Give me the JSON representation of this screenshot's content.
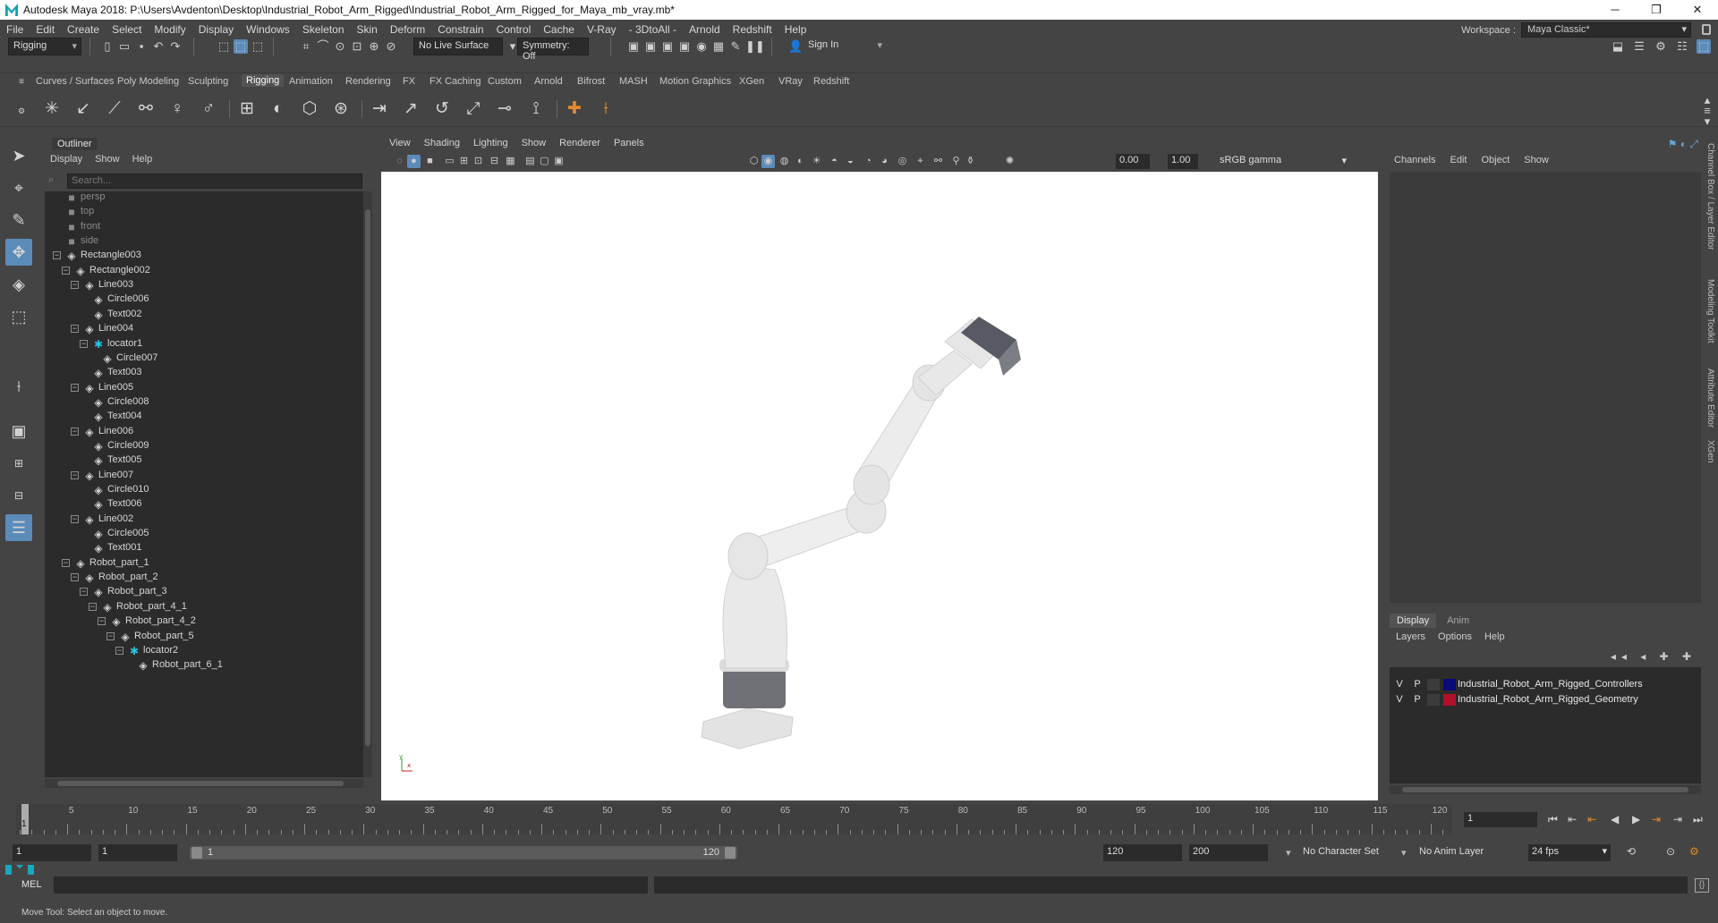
{
  "window": {
    "title": "Autodesk Maya 2018: P:\\Users\\Avdenton\\Desktop\\Industrial_Robot_Arm_Rigged\\Industrial_Robot_Arm_Rigged_for_Maya_mb_vray.mb*",
    "minimize": "─",
    "maximize": "❐",
    "close": "✕"
  },
  "menubar": {
    "items": [
      "File",
      "Edit",
      "Create",
      "Select",
      "Modify",
      "Display",
      "Windows",
      "Skeleton",
      "Skin",
      "Deform",
      "Constrain",
      "Control",
      "Cache",
      "V-Ray",
      "- 3DtoAll -",
      "Arnold",
      "Redshift",
      "Help"
    ],
    "workspace_label": "Workspace :",
    "workspace_value": "Maya Classic*"
  },
  "statusline": {
    "menuset": "Rigging",
    "live_surface": "No Live Surface",
    "symmetry": "Symmetry: Off",
    "sign_in": "Sign In"
  },
  "shelf": {
    "tabs": [
      "Curves / Surfaces",
      "Poly Modeling",
      "Sculpting",
      "Rigging",
      "Animation",
      "Rendering",
      "FX",
      "FX Caching",
      "Custom",
      "Arnold",
      "Bifrost",
      "MASH",
      "Motion Graphics",
      "XGen",
      "VRay",
      "Redshift"
    ],
    "active_tab": "Rigging"
  },
  "outliner": {
    "title": "Outliner",
    "menus": [
      "Display",
      "Show",
      "Help"
    ],
    "search_placeholder": "Search...",
    "rows": [
      {
        "label": "persp",
        "depth": 0,
        "type": "camera",
        "toggle": "",
        "dim": true
      },
      {
        "label": "top",
        "depth": 0,
        "type": "camera",
        "toggle": "",
        "dim": true
      },
      {
        "label": "front",
        "depth": 0,
        "type": "camera",
        "toggle": "",
        "dim": true
      },
      {
        "label": "side",
        "depth": 0,
        "type": "camera",
        "toggle": "",
        "dim": true
      },
      {
        "label": "Rectangle003",
        "depth": 0,
        "type": "transform",
        "toggle": "−",
        "dim": false
      },
      {
        "label": "Rectangle002",
        "depth": 1,
        "type": "transform",
        "toggle": "−",
        "dim": false
      },
      {
        "label": "Line003",
        "depth": 2,
        "type": "transform",
        "toggle": "−",
        "dim": false
      },
      {
        "label": "Circle006",
        "depth": 3,
        "type": "transform",
        "toggle": "",
        "dim": false
      },
      {
        "label": "Text002",
        "depth": 3,
        "type": "transform",
        "toggle": "",
        "dim": false
      },
      {
        "label": "Line004",
        "depth": 2,
        "type": "transform",
        "toggle": "−",
        "dim": false
      },
      {
        "label": "locator1",
        "depth": 3,
        "type": "locator",
        "toggle": "−",
        "dim": false
      },
      {
        "label": "Circle007",
        "depth": 4,
        "type": "transform",
        "toggle": "",
        "dim": false
      },
      {
        "label": "Text003",
        "depth": 3,
        "type": "transform",
        "toggle": "",
        "dim": false
      },
      {
        "label": "Line005",
        "depth": 2,
        "type": "transform",
        "toggle": "−",
        "dim": false
      },
      {
        "label": "Circle008",
        "depth": 3,
        "type": "transform",
        "toggle": "",
        "dim": false
      },
      {
        "label": "Text004",
        "depth": 3,
        "type": "transform",
        "toggle": "",
        "dim": false
      },
      {
        "label": "Line006",
        "depth": 2,
        "type": "transform",
        "toggle": "−",
        "dim": false
      },
      {
        "label": "Circle009",
        "depth": 3,
        "type": "transform",
        "toggle": "",
        "dim": false
      },
      {
        "label": "Text005",
        "depth": 3,
        "type": "transform",
        "toggle": "",
        "dim": false
      },
      {
        "label": "Line007",
        "depth": 2,
        "type": "transform",
        "toggle": "−",
        "dim": false
      },
      {
        "label": "Circle010",
        "depth": 3,
        "type": "transform",
        "toggle": "",
        "dim": false
      },
      {
        "label": "Text006",
        "depth": 3,
        "type": "transform",
        "toggle": "",
        "dim": false
      },
      {
        "label": "Line002",
        "depth": 2,
        "type": "transform",
        "toggle": "−",
        "dim": false
      },
      {
        "label": "Circle005",
        "depth": 3,
        "type": "transform",
        "toggle": "",
        "dim": false
      },
      {
        "label": "Text001",
        "depth": 3,
        "type": "transform",
        "toggle": "",
        "dim": false
      },
      {
        "label": "Robot_part_1",
        "depth": 1,
        "type": "transform",
        "toggle": "−",
        "dim": false
      },
      {
        "label": "Robot_part_2",
        "depth": 2,
        "type": "transform",
        "toggle": "−",
        "dim": false
      },
      {
        "label": "Robot_part_3",
        "depth": 3,
        "type": "transform",
        "toggle": "−",
        "dim": false
      },
      {
        "label": "Robot_part_4_1",
        "depth": 4,
        "type": "transform",
        "toggle": "−",
        "dim": false
      },
      {
        "label": "Robot_part_4_2",
        "depth": 5,
        "type": "transform",
        "toggle": "−",
        "dim": false
      },
      {
        "label": "Robot_part_5",
        "depth": 6,
        "type": "transform",
        "toggle": "−",
        "dim": false
      },
      {
        "label": "locator2",
        "depth": 7,
        "type": "locator",
        "toggle": "−",
        "dim": false
      },
      {
        "label": "Robot_part_6_1",
        "depth": 8,
        "type": "transform",
        "toggle": "",
        "dim": false
      }
    ]
  },
  "viewport": {
    "menus": [
      "View",
      "Shading",
      "Lighting",
      "Show",
      "Renderer",
      "Panels"
    ],
    "exposure": "0.00",
    "gamma": "1.00",
    "color_space": "sRGB gamma"
  },
  "channelbox": {
    "menus": [
      "Channels",
      "Edit",
      "Object",
      "Show"
    ],
    "tabs": [
      "Display",
      "Anim"
    ],
    "layer_menus": [
      "Layers",
      "Options",
      "Help"
    ],
    "layers": [
      {
        "v": "V",
        "p": "P",
        "color": "#0a0a7a",
        "name": "Industrial_Robot_Arm_Rigged_Controllers"
      },
      {
        "v": "V",
        "p": "P",
        "color": "#b0102a",
        "name": "Industrial_Robot_Arm_Rigged_Geometry"
      }
    ]
  },
  "sidetabs": [
    "Channel Box / Layer Editor",
    "Modeling Toolkit",
    "Attribute Editor",
    "XGen"
  ],
  "timeslider": {
    "ticks": [
      "5",
      "10",
      "15",
      "20",
      "25",
      "30",
      "35",
      "40",
      "45",
      "50",
      "55",
      "60",
      "65",
      "70",
      "75",
      "80",
      "85",
      "90",
      "95",
      "100",
      "105",
      "110",
      "115",
      "120"
    ],
    "start_frame_label": "1",
    "current_frame": "1"
  },
  "rangeslider": {
    "start": "1",
    "playback_start": "1",
    "range_start_label": "1",
    "range_end_label": "120",
    "playback_end": "120",
    "end": "200",
    "character_set": "No Character Set",
    "anim_layer": "No Anim Layer",
    "fps": "24 fps"
  },
  "cmdline": {
    "label": "MEL"
  },
  "helpline": {
    "text": "Move Tool: Select an object to move."
  }
}
